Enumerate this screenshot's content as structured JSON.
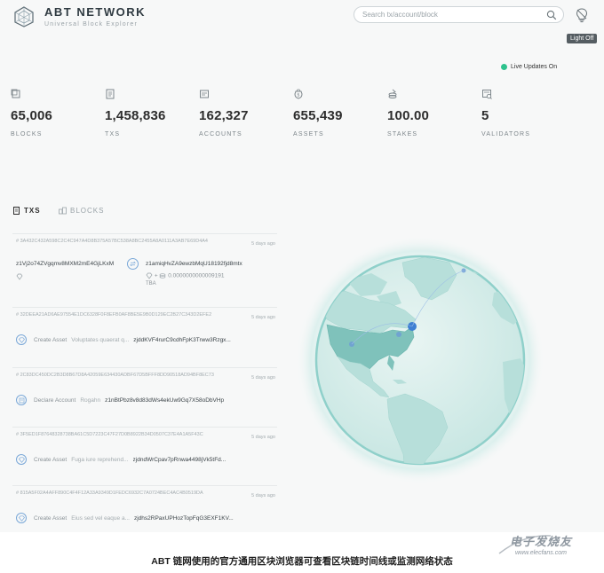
{
  "header": {
    "title": "ABT NETWORK",
    "subtitle": "Universal Block Explorer",
    "search_placeholder": "Search tx/account/block",
    "theme_tooltip": "Light Off"
  },
  "live_updates": "Live Updates On",
  "stats": [
    {
      "value": "65,006",
      "label": "BLOCKS",
      "icon": "block-icon"
    },
    {
      "value": "1,458,836",
      "label": "TXS",
      "icon": "document-icon"
    },
    {
      "value": "162,327",
      "label": "ACCOUNTS",
      "icon": "account-icon"
    },
    {
      "value": "655,439",
      "label": "ASSETS",
      "icon": "asset-icon"
    },
    {
      "value": "100.00",
      "label": "STAKES",
      "icon": "stake-icon"
    },
    {
      "value": "5",
      "label": "VALIDATORS",
      "icon": "validator-icon"
    }
  ],
  "tabs": [
    {
      "label": "TXS",
      "icon": "document-icon",
      "active": true
    },
    {
      "label": "BLOCKS",
      "icon": "blocks-icon",
      "active": false
    }
  ],
  "txs": [
    {
      "hash": "# 3A432C432A598C2C4C947A4D8B375A57BC538A8BC2455A8A0111A3AB7E69D4A4",
      "time": "5 days ago",
      "from": "z1Vj2o74ZVgqmv8MXM2mE4GjLKxM",
      "to": "z1amiqHvZA9ewzbMqU18192fjd8mtx",
      "amount": "0.0000000000009191",
      "unit": "TBA"
    },
    {
      "hash": "# 32DEEA21AD6AE97554E1DC6328F0F8EFB0AF8BE5E9B0D129EC2B27C343D2EFE2",
      "time": "5 days ago",
      "type": "Create Asset",
      "desc": "Voluptates quaerat q...",
      "address": "zjddKVF4rurC9cdhFpK3Trww3Rzgx..."
    },
    {
      "hash": "# 2C83DC450DC2B3D8B67D8A42059E634430ADBF67D5BFFF8DD90518AD94BF8EC73",
      "time": "5 days ago",
      "type": "Declare Account",
      "desc": "Rogahn",
      "address": "z1nBtPbz8v8d83dWs4ekUw9Gq7X58oDbVHp"
    },
    {
      "hash": "# 3F5ED1F87648328738BA61C5D7223C47F27D0B8922B34D0507C37E4A1A5F43C",
      "time": "5 days ago",
      "type": "Create Asset",
      "desc": "Fuga iure reprehend...",
      "address": "zjdndWrCpav7pRnwa4498jVk5tFd..."
    },
    {
      "hash": "# 815A5F02A4AFF890C4F4F12A33A9349D1FEDC6932C7A0724BEC4AC4B0519DA",
      "time": "5 days ago",
      "type": "Create Asset",
      "desc": "Eius sed vel eaque a...",
      "address": "zjdhs2RPaxUPHozTopFqG3EXF1KV..."
    }
  ],
  "caption": "ABT 链网使用的官方通用区块浏览器可查看区块链时间线或监测网络状态",
  "watermark": {
    "text": "电子发烧友",
    "url": "www.elecfans.com"
  },
  "colors": {
    "accent": "#2ec28d",
    "link_blue": "#7aa8d8",
    "globe": "#a9dbd8"
  }
}
